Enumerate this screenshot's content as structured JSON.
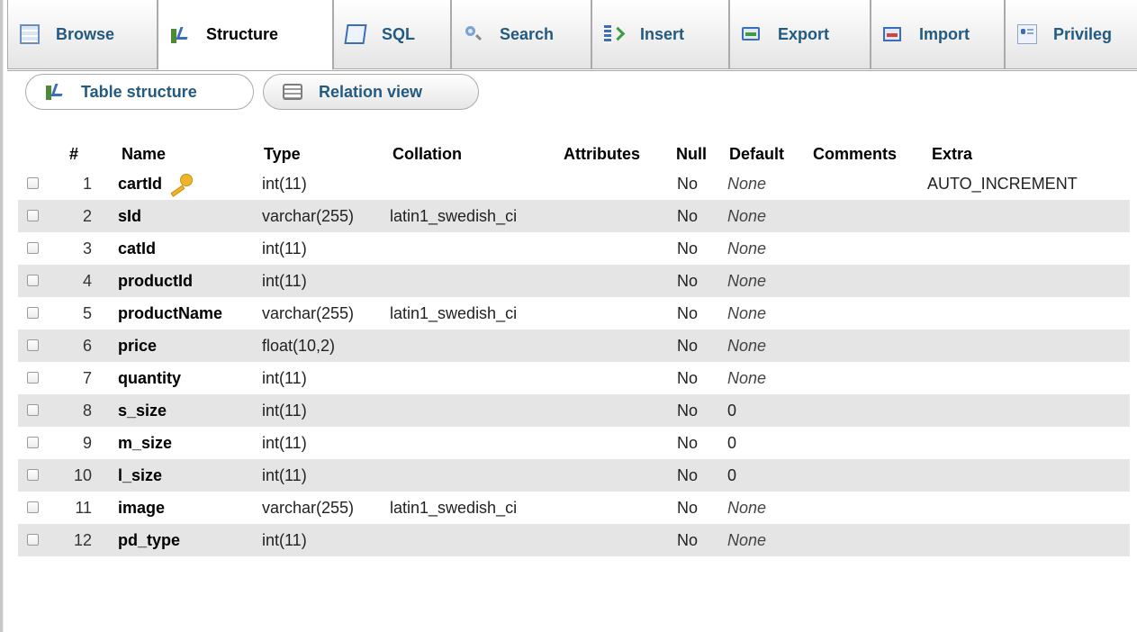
{
  "tabs": [
    {
      "label": "Browse",
      "icon": "table-browse-icon",
      "active": false
    },
    {
      "label": "Structure",
      "icon": "structure-icon",
      "active": true
    },
    {
      "label": "SQL",
      "icon": "sql-icon",
      "active": false
    },
    {
      "label": "Search",
      "icon": "magnifier-icon",
      "active": false
    },
    {
      "label": "Insert",
      "icon": "insert-row-icon",
      "active": false
    },
    {
      "label": "Export",
      "icon": "export-icon",
      "active": false
    },
    {
      "label": "Import",
      "icon": "import-icon",
      "active": false
    },
    {
      "label": "Privileg",
      "icon": "privileges-icon",
      "active": false
    }
  ],
  "subnav": {
    "table_structure": "Table structure",
    "relation_view": "Relation view"
  },
  "columns_header": {
    "num": "#",
    "name": "Name",
    "type": "Type",
    "collation": "Collation",
    "attributes": "Attributes",
    "null": "Null",
    "default": "Default",
    "comments": "Comments",
    "extra": "Extra"
  },
  "rows": [
    {
      "num": "1",
      "name": "cartId",
      "primary_key": true,
      "type": "int(11)",
      "collation": "",
      "attributes": "",
      "null": "No",
      "default": "None",
      "comments": "",
      "extra": "AUTO_INCREMENT"
    },
    {
      "num": "2",
      "name": "sId",
      "primary_key": false,
      "type": "varchar(255)",
      "collation": "latin1_swedish_ci",
      "attributes": "",
      "null": "No",
      "default": "None",
      "comments": "",
      "extra": ""
    },
    {
      "num": "3",
      "name": "catId",
      "primary_key": false,
      "type": "int(11)",
      "collation": "",
      "attributes": "",
      "null": "No",
      "default": "None",
      "comments": "",
      "extra": ""
    },
    {
      "num": "4",
      "name": "productId",
      "primary_key": false,
      "type": "int(11)",
      "collation": "",
      "attributes": "",
      "null": "No",
      "default": "None",
      "comments": "",
      "extra": ""
    },
    {
      "num": "5",
      "name": "productName",
      "primary_key": false,
      "type": "varchar(255)",
      "collation": "latin1_swedish_ci",
      "attributes": "",
      "null": "No",
      "default": "None",
      "comments": "",
      "extra": ""
    },
    {
      "num": "6",
      "name": "price",
      "primary_key": false,
      "type": "float(10,2)",
      "collation": "",
      "attributes": "",
      "null": "No",
      "default": "None",
      "comments": "",
      "extra": ""
    },
    {
      "num": "7",
      "name": "quantity",
      "primary_key": false,
      "type": "int(11)",
      "collation": "",
      "attributes": "",
      "null": "No",
      "default": "None",
      "comments": "",
      "extra": ""
    },
    {
      "num": "8",
      "name": "s_size",
      "primary_key": false,
      "type": "int(11)",
      "collation": "",
      "attributes": "",
      "null": "No",
      "default": "0",
      "comments": "",
      "extra": ""
    },
    {
      "num": "9",
      "name": "m_size",
      "primary_key": false,
      "type": "int(11)",
      "collation": "",
      "attributes": "",
      "null": "No",
      "default": "0",
      "comments": "",
      "extra": ""
    },
    {
      "num": "10",
      "name": "l_size",
      "primary_key": false,
      "type": "int(11)",
      "collation": "",
      "attributes": "",
      "null": "No",
      "default": "0",
      "comments": "",
      "extra": ""
    },
    {
      "num": "11",
      "name": "image",
      "primary_key": false,
      "type": "varchar(255)",
      "collation": "latin1_swedish_ci",
      "attributes": "",
      "null": "No",
      "default": "None",
      "comments": "",
      "extra": ""
    },
    {
      "num": "12",
      "name": "pd_type",
      "primary_key": false,
      "type": "int(11)",
      "collation": "",
      "attributes": "",
      "null": "No",
      "default": "None",
      "comments": "",
      "extra": ""
    }
  ]
}
